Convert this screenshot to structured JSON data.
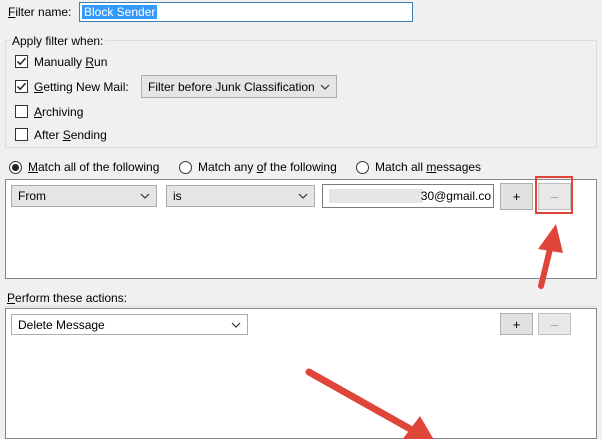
{
  "filter_name": {
    "label": "Filter name:",
    "value": "Block Sender"
  },
  "apply_when": {
    "title": "Apply filter when:",
    "options": [
      {
        "label": "Manually Run",
        "checked": true
      },
      {
        "label": "Getting New Mail:",
        "checked": true
      },
      {
        "label": "Archiving",
        "checked": false
      },
      {
        "label": "After Sending",
        "checked": false
      }
    ],
    "new_mail_mode": "Filter before Junk Classification"
  },
  "match": {
    "options": [
      {
        "label": "Match all of the following",
        "selected": true
      },
      {
        "label": "Match any of the following",
        "selected": false
      },
      {
        "label": "Match all messages",
        "selected": false
      }
    ]
  },
  "rule": {
    "field": "From",
    "operator": "is",
    "value": "​30@gmail.co",
    "add_label": "+",
    "remove_label": "–"
  },
  "actions": {
    "title": "Perform these actions:",
    "action": "Delete Message",
    "add_label": "+",
    "remove_label": "–"
  },
  "colors": {
    "annotation": "#e0453a",
    "selection": "#3399ff"
  }
}
